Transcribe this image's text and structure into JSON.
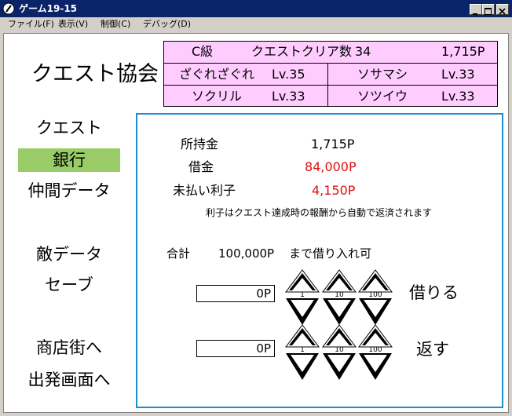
{
  "window": {
    "title": "ゲーム19-15"
  },
  "menu": [
    {
      "label": "ファイル(F)"
    },
    {
      "label": "表示(V)"
    },
    {
      "label": "制御(C)"
    },
    {
      "label": "デバッグ(D)"
    }
  ],
  "header": {
    "org_title": "クエスト協会"
  },
  "status": {
    "rank": "C級",
    "quest_clear_label": "クエストクリア数",
    "quest_clear_count": "34",
    "money": "1,715P",
    "party": [
      {
        "name": "ざぐれざぐれ",
        "level": "Lv.35"
      },
      {
        "name": "ソサマシ",
        "level": "Lv.33"
      },
      {
        "name": "ソクリル",
        "level": "Lv.33"
      },
      {
        "name": "ソツイウ",
        "level": "Lv.33"
      }
    ]
  },
  "nav": {
    "items": [
      {
        "label": "クエスト"
      },
      {
        "label": "銀行"
      },
      {
        "label": "仲間データ"
      },
      {
        "label": "敵データ"
      },
      {
        "label": "セーブ"
      },
      {
        "label": "商店街へ"
      },
      {
        "label": "出発画面へ"
      }
    ],
    "selected": "銀行",
    "selected_color": "#99cc66"
  },
  "bank": {
    "funds_label": "所持金",
    "funds_value": "1,715P",
    "debt_label": "借金",
    "debt_value": "84,000P",
    "unpaid_interest_label": "未払い利子",
    "unpaid_interest_value": "4,150P",
    "note": "利子はクエスト達成時の報酬から自動で返済されます",
    "total_label": "合計",
    "total_value": "100,000P",
    "total_suffix": "まで借り入れ可",
    "borrow": {
      "amount": "0P",
      "label": "借りる",
      "steps": [
        "1",
        "10",
        "100"
      ]
    },
    "repay": {
      "amount": "0P",
      "label": "返す",
      "steps": [
        "1",
        "10",
        "100"
      ]
    },
    "highlight_color": "#e01010",
    "panel_border_color": "#1a8fd6"
  }
}
